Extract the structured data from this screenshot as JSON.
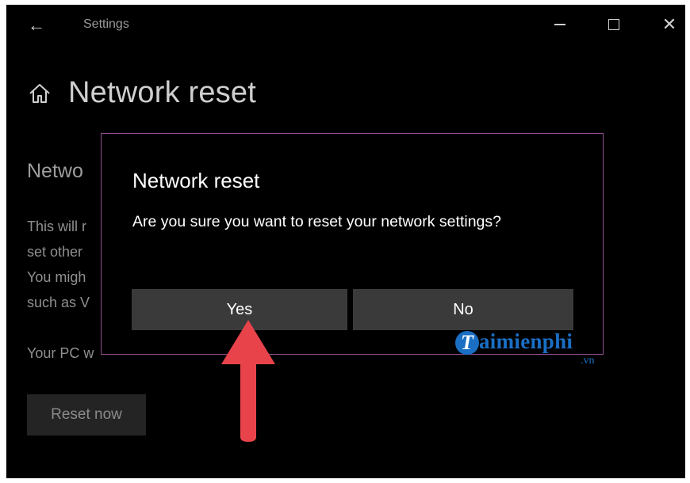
{
  "window": {
    "app_title": "Settings",
    "controls": {
      "minimize": "minimize",
      "maximize": "maximize",
      "close": "close"
    }
  },
  "page": {
    "title": "Network reset",
    "section_title": "Netwo",
    "description_lines": [
      "This will r",
      "set other",
      "You migh",
      "such as V"
    ],
    "restart_note_prefix": "Your PC w",
    "reset_now_label": "Reset now"
  },
  "dialog": {
    "title": "Network reset",
    "message": "Are you sure you want to reset your network settings?",
    "yes_label": "Yes",
    "no_label": "No"
  },
  "annotation": {
    "arrow_color": "#e8434b",
    "points_to": "Yes"
  },
  "watermark": {
    "logo_letter": "T",
    "brand": "aimienphi",
    "suffix": ".vn",
    "color": "#1a6fc4"
  },
  "colors": {
    "window_bg": "#000000",
    "dialog_border": "#8f4f8f",
    "button_bg": "#3a3a3a",
    "reset_button_bg": "#242424"
  }
}
